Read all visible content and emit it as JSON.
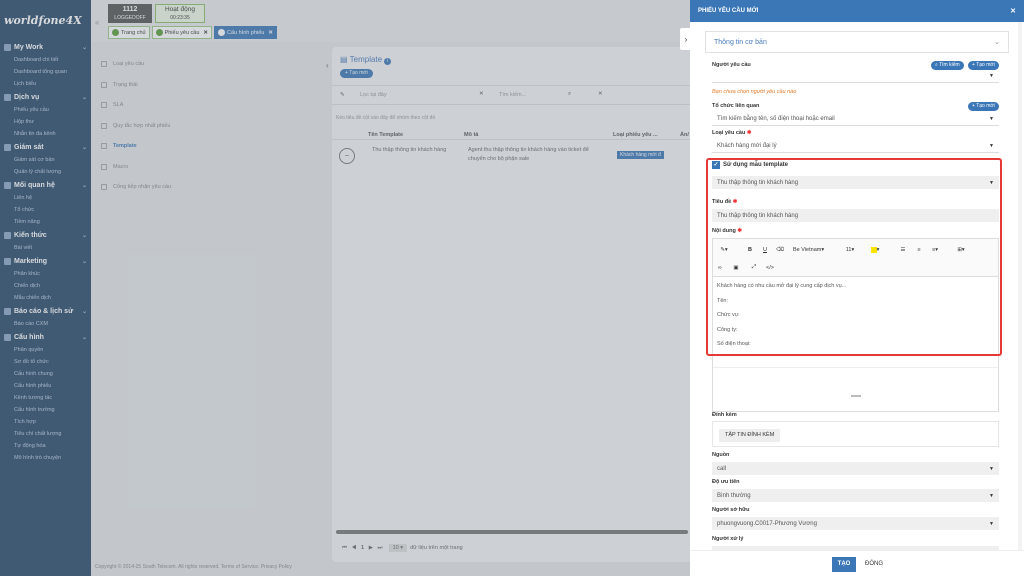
{
  "sidebar": {
    "logo": "worldfone4X",
    "groups": [
      {
        "title": "My Work",
        "items": [
          "Dashboard chi tiết",
          "Dashboard tổng quan",
          "Lịch biểu"
        ]
      },
      {
        "title": "Dịch vụ",
        "items": [
          "Phiếu yêu cầu",
          "Hộp thư",
          "Nhắn tin đa kênh"
        ]
      },
      {
        "title": "Giám sát",
        "items": [
          "Giám sát cơ bản",
          "Quản lý chất lượng"
        ]
      },
      {
        "title": "Mối quan hệ",
        "items": [
          "Liên hệ",
          "Tổ chức",
          "Tiềm năng"
        ]
      },
      {
        "title": "Kiến thức",
        "items": [
          "Bài viết"
        ]
      },
      {
        "title": "Marketing",
        "items": [
          "Phân khúc",
          "Chiến dịch",
          "Mẫu chiến dịch"
        ]
      },
      {
        "title": "Báo cáo & lịch sử",
        "items": [
          "Báo cáo CXM"
        ]
      },
      {
        "title": "Cấu hình",
        "items": [
          "Phân quyền",
          "Sơ đồ tổ chức",
          "Cấu hình chung",
          "Cấu hình phiếu",
          "Kênh tương tác",
          "Cấu hình trường",
          "Tích hợp",
          "Tiêu chí chất lượng",
          "Tự động hóa",
          "Mô hình trò chuyện"
        ]
      }
    ]
  },
  "header": {
    "extension": "1112",
    "extension_status": "LOGGEDOFF",
    "activity_label": "Hoạt động",
    "activity_time": "00:23:35",
    "tabs": [
      {
        "label": "Trang chủ",
        "closable": false
      },
      {
        "label": "Phiếu yêu cầu",
        "closable": true
      },
      {
        "label": "Cấu hình phiếu",
        "closable": true,
        "active": true
      }
    ]
  },
  "main": {
    "left_nav": [
      "Loại yêu cầu",
      "Trạng thái",
      "SLA",
      "Quy tắc hợp nhất phiếu",
      "Template",
      "Macro",
      "Cổng tiếp nhận yêu cầu"
    ],
    "left_nav_active": "Template",
    "panel_title": "Template",
    "new_button": "Tạo mới",
    "filter_placeholder": "Lọc tại đây",
    "search_placeholder": "Tìm kiếm...",
    "hint": "Kéo tiêu đề cột vào đây để nhóm theo cột đó",
    "columns": [
      "Tên Template",
      "Mô tả",
      "Loại phiếu yêu ...",
      "Ẩn/"
    ],
    "rows": [
      {
        "name": "Thu thập thông tin khách hàng",
        "description": "Agent thu thập thông tin khách hàng vào ticket để chuyển cho bộ phận sale",
        "type": "Khách hàng mới đ"
      }
    ],
    "pager_page": "1",
    "page_size": "10",
    "pager_empty": "dữ liệu trên một trang",
    "footer": "Copyright © 2014-25 South Telecom. All rights reserved. Terms of Service. Privacy Policy"
  },
  "drawer": {
    "title": "PHIẾU YÊU CẦU MỚI",
    "section_title": "Thông tin cơ bản",
    "requester_label": "Người yêu cầu",
    "search_btn": "Tìm kiếm",
    "new_btn": "Tạo mới",
    "requester_warning": "Bạn chưa chọn người yêu cầu nào",
    "org_label": "Tổ chức liên quan",
    "org_placeholder": "Tìm kiếm bằng tên, số điện thoại hoặc email",
    "type_label": "Loại yêu cầu",
    "type_value": "Khách hàng mới đại lý",
    "use_template_label": "Sử dụng mẫu template",
    "template_value": "Thu thập thông tin khách hàng",
    "subject_label": "Tiêu đề",
    "subject_value": "Thu thập thông tin khách hàng",
    "content_label": "Nội dung",
    "toolbar": {
      "font": "Be Vietnam",
      "size": "11"
    },
    "content_lines": [
      "Khách hàng có nhu cầu mở đại lý cung cấp dịch vụ...",
      "Tên:",
      "Chức vụ:",
      "Công ty:",
      "Số điện thoại:"
    ],
    "attachment_label": "Đính kèm",
    "attachment_btn": "TẬP TIN ĐÍNH KÈM",
    "source_label": "Nguồn",
    "source_value": "call",
    "priority_label": "Độ ưu tiên",
    "priority_value": "Bình thường",
    "owner_label": "Người sở hữu",
    "owner_value": "phuongvuong.C0017-Phương Vương",
    "handler_label": "Người xử lý",
    "create_btn": "TẠO",
    "close_btn": "ĐÓNG"
  }
}
